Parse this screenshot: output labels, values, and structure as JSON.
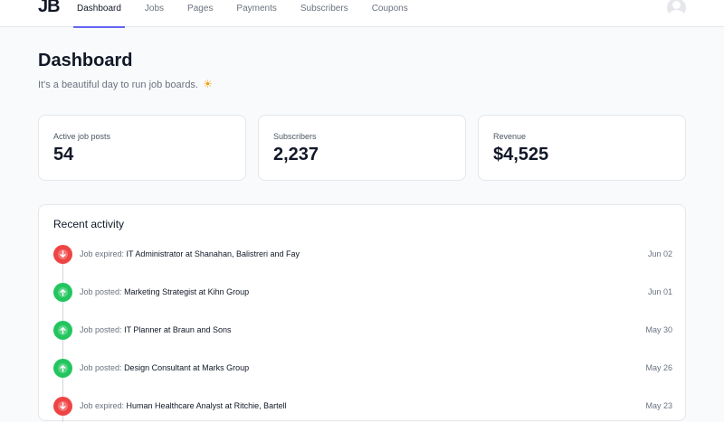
{
  "header": {
    "logo": "JB",
    "nav": [
      {
        "label": "Dashboard",
        "active": true
      },
      {
        "label": "Jobs",
        "active": false
      },
      {
        "label": "Pages",
        "active": false
      },
      {
        "label": "Payments",
        "active": false
      },
      {
        "label": "Subscribers",
        "active": false
      },
      {
        "label": "Coupons",
        "active": false
      }
    ],
    "avatar_icon": "user-avatar-icon"
  },
  "page": {
    "title": "Dashboard",
    "subtitle": "It's a beautiful day to run job boards.",
    "subtitle_icon": "sun-icon"
  },
  "stats": [
    {
      "label": "Active job posts",
      "value": "54"
    },
    {
      "label": "Subscribers",
      "value": "2,237"
    },
    {
      "label": "Revenue",
      "value": "$4,525"
    }
  ],
  "activity": {
    "title": "Recent activity",
    "items": [
      {
        "type": "Job expired:",
        "text": "IT Administrator at Shanahan, Balistreri and Fay",
        "date": "Jun 02",
        "status": "expired",
        "icon": "arrow-down-icon"
      },
      {
        "type": "Job posted:",
        "text": "Marketing Strategist at Kihn Group",
        "date": "Jun 01",
        "status": "posted",
        "icon": "arrow-up-icon"
      },
      {
        "type": "Job posted:",
        "text": "IT Planner at Braun and Sons",
        "date": "May 30",
        "status": "posted",
        "icon": "arrow-up-icon"
      },
      {
        "type": "Job posted:",
        "text": "Design Consultant at Marks Group",
        "date": "May 26",
        "status": "posted",
        "icon": "arrow-up-icon"
      },
      {
        "type": "Job expired:",
        "text": "Human Healthcare Analyst at Ritchie, Bartell",
        "date": "May 23",
        "status": "expired",
        "icon": "arrow-down-icon"
      }
    ]
  },
  "colors": {
    "accent": "#6366f1",
    "posted": "#22c55e",
    "expired": "#ef4444"
  }
}
